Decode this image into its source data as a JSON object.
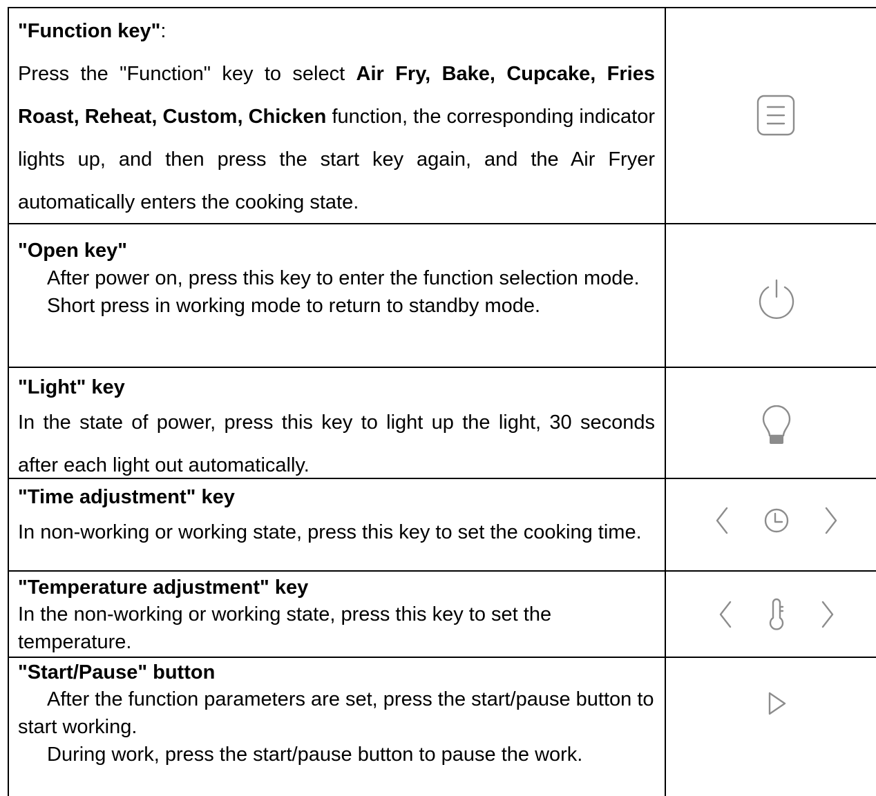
{
  "rows": [
    {
      "heading": "\"Function key\"",
      "heading_suffix": ":",
      "body_pre": "Press the \"Function\" key to select ",
      "body_bold": "Air Fry, Bake, Cupcake, Fries Roast, Reheat, Custom, Chicken",
      "body_post": " function, the corresponding indicator lights up, and then press the start key again, and the Air Fryer automatically enters the cooking state.",
      "icons": [
        "menu-icon"
      ]
    },
    {
      "heading": "\"Open key\"",
      "line1": "After power on, press this key to enter the function selection mode.",
      "line2": "Short press in working mode to return to standby mode.",
      "icons": [
        "power-icon"
      ]
    },
    {
      "heading": "\"Light\" key",
      "body": "In the state of power, press this key to light up the light, 30 seconds after each light out automatically.",
      "icons": [
        "light-bulb-icon"
      ]
    },
    {
      "heading": "\"Time adjustment\" key",
      "body": "In non-working or working state, press this key to set the cooking time.",
      "icons": [
        "chevron-left-icon",
        "clock-icon",
        "chevron-right-icon"
      ]
    },
    {
      "heading": "\"Temperature adjustment\" key",
      "body": "In the non-working or working state, press this key to set the temperature.",
      "icons": [
        "chevron-left-icon",
        "thermometer-icon",
        "chevron-right-icon"
      ]
    },
    {
      "heading": "\"Start/Pause\" button",
      "line1": "After the function parameters are set, press the start/pause button to start working.",
      "line2": "During work, press the start/pause button to pause the work.",
      "icons": [
        "play-icon"
      ]
    }
  ],
  "colors": {
    "icon": "#8c8c8c",
    "border": "#000000"
  }
}
